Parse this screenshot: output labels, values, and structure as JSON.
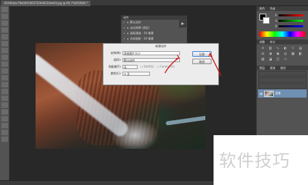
{
  "document_tab": {
    "title": "20190abc78a0401005763fa6224de03.jpg @ 66.7%(RGB/8) *",
    "close": "×"
  },
  "tabbar_extra": "",
  "actions_panel": {
    "tab": "动作",
    "rows": [
      {
        "check": "✓",
        "label": "默认动作"
      },
      {
        "check": "✓",
        "label": "淡出效果 (选区)"
      },
      {
        "check": "✓",
        "label": "画框通道 - 50 像素"
      },
      {
        "check": "✓",
        "label": "木质画框 - 50 像素"
      }
    ],
    "side_button": "▶"
  },
  "dialog": {
    "title": "新建动作",
    "name_label": "名称(N):",
    "name_value": "改变图片大小",
    "set_label": "组(E):",
    "set_value": "默认动作",
    "fkey_label": "功能键(F):",
    "fkey_value": "无",
    "shift_label": "Shift(S)",
    "control_label": "Control(O)",
    "color_label": "颜色(C):",
    "color_value": "× 无",
    "record_button": "记录",
    "cancel_button": "取消"
  },
  "right_panel": {
    "color_tabs": [
      "颜色",
      "色板"
    ],
    "channels": [
      "R",
      "G",
      "B"
    ],
    "adjust_tabs": [
      "调整",
      "样式"
    ],
    "layers_tabs": [
      "图层",
      "通道",
      "路径"
    ],
    "layer_name": "背景",
    "layer_eye": "👁"
  },
  "watermark_text": "软件技巧",
  "colors": {
    "accent_arrow": "#d21a1a",
    "layer_selected": "#6f8fb3"
  }
}
